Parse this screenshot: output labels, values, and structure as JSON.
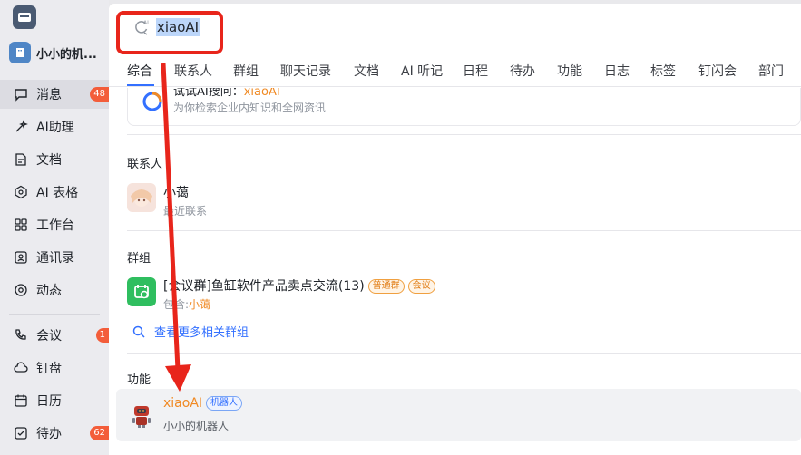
{
  "sidebar": {
    "org_name": "小小的机...",
    "items": [
      {
        "label": "消息",
        "badge": "48",
        "icon": "message-icon"
      },
      {
        "label": "AI助理",
        "icon": "sparkle-icon"
      },
      {
        "label": "文档",
        "icon": "document-icon"
      },
      {
        "label": "AI 表格",
        "icon": "table-icon"
      },
      {
        "label": "工作台",
        "icon": "grid-icon"
      },
      {
        "label": "通讯录",
        "icon": "contacts-icon"
      },
      {
        "label": "动态",
        "icon": "eye-icon"
      },
      {
        "label": "会议",
        "badge": "1",
        "icon": "phone-icon"
      },
      {
        "label": "钉盘",
        "icon": "drive-icon"
      },
      {
        "label": "日历",
        "icon": "calendar-icon"
      },
      {
        "label": "待办",
        "badge": "62",
        "icon": "todo-icon"
      }
    ]
  },
  "search": {
    "query": "xiaoAI",
    "tabs": [
      "综合",
      "联系人",
      "群组",
      "聊天记录",
      "文档",
      "AI 听记",
      "日程",
      "待办",
      "功能",
      "日志",
      "标签",
      "钉闪会",
      "部门"
    ]
  },
  "ai_card": {
    "title_prefix": "试试AI搜问：",
    "title_query": "xiaoAI",
    "subtitle": "为你检索企业内知识和全网资讯"
  },
  "contacts": {
    "section_title": "联系人",
    "name": "小蔼",
    "subtitle": "最近联系"
  },
  "groups": {
    "section_title": "群组",
    "name": "[会议群]鱼缸软件产品卖点交流(13)",
    "tag1": "普通群",
    "tag2": "会议",
    "sub_prefix": "包含:",
    "sub_match": "小蔼",
    "more_link": "查看更多相关群组"
  },
  "features": {
    "section_title": "功能",
    "name": "xiaoAI",
    "tag": "机器人",
    "subtitle": "小小的机器人"
  },
  "colors": {
    "accent": "#3370ff",
    "highlight": "#f08a24",
    "annotation": "#e8251b"
  }
}
